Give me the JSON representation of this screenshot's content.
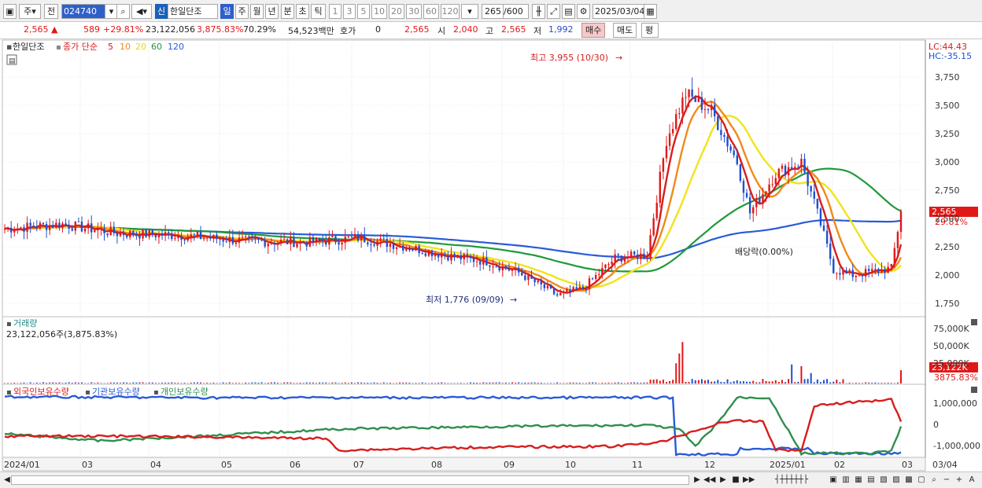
{
  "toolbar": {
    "type_label": "주",
    "prev_label": "전",
    "code": "024740",
    "shin_label": "신",
    "stock_name": "한일단조",
    "periods": [
      "일",
      "주",
      "월",
      "년",
      "분",
      "초",
      "틱"
    ],
    "active_period": "일",
    "intervals": [
      "1",
      "3",
      "5",
      "10",
      "20",
      "30",
      "60",
      "120"
    ],
    "count": "265",
    "count_total": "/600",
    "date": "2025/03/04"
  },
  "info": {
    "price": "2,565",
    "change": "589",
    "change_pct": "+29.81%",
    "volume": "23,122,056",
    "vol_pct": "3,875.83%",
    "rate": "70.29%",
    "amount": "54,523백만",
    "hoga_label": "호가",
    "hoga_value": "0",
    "ask_price": "2,565",
    "open_label": "시",
    "open_value": "2,040",
    "high_label": "고",
    "high_value": "2,565",
    "low_label": "저",
    "low_value": "1,992",
    "buy_label": "매수",
    "sell_label": "매도",
    "eval_label": "평"
  },
  "price_chart": {
    "stock_label": "한일단조",
    "ma_label": "종가 단순",
    "ma_periods": [
      "5",
      "10",
      "20",
      "60",
      "120"
    ],
    "lc": "LC:44.43",
    "hc": "HC:-35.15",
    "y_ticks": [
      "3,750",
      "3,500",
      "3,250",
      "3,000",
      "2,750",
      "2,500",
      "2,250",
      "2,000",
      "1,750"
    ],
    "high_annotation": "최고 3,955 (10/30)",
    "low_annotation": "최저 1,776 (09/09)",
    "dividend_annotation": "배당락(0.00%)",
    "current_price_tag": "2,565",
    "current_pct_tag": "29.81%"
  },
  "volume_chart": {
    "title": "거래량",
    "subtitle": "23,122,056주(3,875.83%)",
    "y_ticks": [
      "75,000K",
      "50,000K",
      "25,000K"
    ],
    "current_tag": "23,122K",
    "current_pct": "3875.83%"
  },
  "holding_chart": {
    "legend": [
      "외국인보유수량",
      "기관보유수량",
      "개인보유수량"
    ],
    "y_ticks": [
      "1,000,000",
      "0",
      "-1,000,000"
    ]
  },
  "x_axis": [
    "2024/01",
    "03",
    "04",
    "05",
    "06",
    "07",
    "08",
    "09",
    "10",
    "11",
    "12",
    "2025/01",
    "02",
    "03",
    "03/04"
  ],
  "colors": {
    "up": "#e11818",
    "down": "#1f4fd0",
    "ma5": "#d81d1d",
    "ma10": "#f08a1a",
    "ma20": "#f2e31c",
    "ma60": "#1f9a3a",
    "ma120": "#2a5bd7",
    "foreign": "#d81d1d",
    "institution": "#2a5bd7",
    "individual": "#2f8f4f"
  }
}
